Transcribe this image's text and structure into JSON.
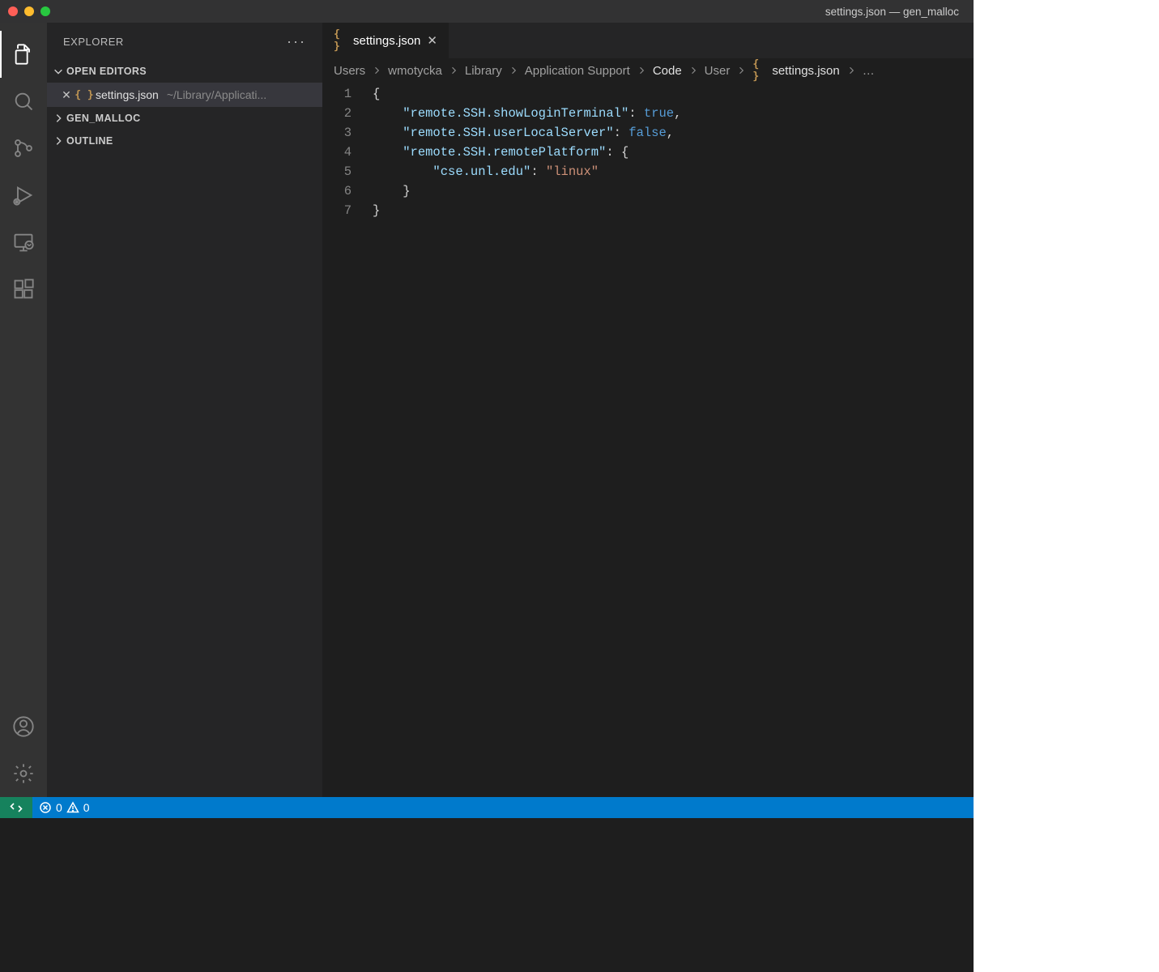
{
  "window": {
    "title": "settings.json — gen_malloc"
  },
  "sidebar": {
    "title": "EXPLORER",
    "sections": {
      "open_editors": {
        "label": "OPEN EDITORS",
        "items": [
          {
            "icon": "{ }",
            "filename": "settings.json",
            "path": "~/Library/Applicati..."
          }
        ]
      },
      "workspace": {
        "label": "GEN_MALLOC"
      },
      "outline": {
        "label": "OUTLINE"
      }
    }
  },
  "tab": {
    "icon": "{ }",
    "label": "settings.json"
  },
  "breadcrumbs": {
    "parts": [
      "Users",
      "wmotycka",
      "Library",
      "Application Support",
      "Code",
      "User"
    ],
    "file_icon": "{ }",
    "file": "settings.json",
    "trailing": "…"
  },
  "code": {
    "lines": [
      {
        "n": "1",
        "segments": [
          {
            "t": "{",
            "c": "punc"
          }
        ]
      },
      {
        "n": "2",
        "segments": [
          {
            "t": "    ",
            "c": "punc"
          },
          {
            "t": "\"remote.SSH.showLoginTerminal\"",
            "c": "key"
          },
          {
            "t": ": ",
            "c": "punc"
          },
          {
            "t": "true",
            "c": "bool"
          },
          {
            "t": ",",
            "c": "punc"
          }
        ]
      },
      {
        "n": "3",
        "segments": [
          {
            "t": "    ",
            "c": "punc"
          },
          {
            "t": "\"remote.SSH.userLocalServer\"",
            "c": "key"
          },
          {
            "t": ": ",
            "c": "punc"
          },
          {
            "t": "false",
            "c": "bool"
          },
          {
            "t": ",",
            "c": "punc"
          }
        ]
      },
      {
        "n": "4",
        "segments": [
          {
            "t": "    ",
            "c": "punc"
          },
          {
            "t": "\"remote.SSH.remotePlatform\"",
            "c": "key"
          },
          {
            "t": ": {",
            "c": "punc"
          }
        ]
      },
      {
        "n": "5",
        "segments": [
          {
            "t": "        ",
            "c": "punc"
          },
          {
            "t": "\"cse.unl.edu\"",
            "c": "key"
          },
          {
            "t": ": ",
            "c": "punc"
          },
          {
            "t": "\"linux\"",
            "c": "str"
          }
        ]
      },
      {
        "n": "6",
        "segments": [
          {
            "t": "    }",
            "c": "punc"
          }
        ]
      },
      {
        "n": "7",
        "segments": [
          {
            "t": "}",
            "c": "punc"
          }
        ]
      }
    ]
  },
  "status": {
    "errors": "0",
    "warnings": "0"
  }
}
